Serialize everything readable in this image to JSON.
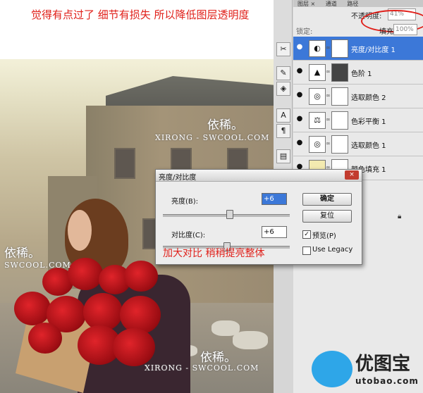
{
  "annotations": {
    "top_note": "觉得有点过了  细节有损失   所以降低图层透明度",
    "dialog_note": "加大对比   稍稍提亮整体"
  },
  "watermarks": [
    {
      "cn": "依稀。",
      "en": "XIRONG - SWCOOL.COM"
    },
    {
      "cn": "依稀。",
      "en": "SWCOOL.COM"
    },
    {
      "cn": "依稀。",
      "en": "XIRONG - SWCOOL.COM"
    }
  ],
  "layers_panel": {
    "tabs": [
      "图层 ×",
      "通道",
      "路径"
    ],
    "opacity_label": "不透明度:",
    "opacity_value": "41%",
    "lock_label": "锁定:",
    "fill_label": "填充:",
    "fill_value": "100%",
    "layers": [
      {
        "name": "亮度/对比度 1",
        "selected": true,
        "icon": "brightness-contrast-icon"
      },
      {
        "name": "色阶 1",
        "selected": false,
        "icon": "levels-icon"
      },
      {
        "name": "选取颜色 2",
        "selected": false,
        "icon": "selective-color-icon"
      },
      {
        "name": "色彩平衡 1",
        "selected": false,
        "icon": "color-balance-icon"
      },
      {
        "name": "选取颜色 1",
        "selected": false,
        "icon": "selective-color-icon"
      },
      {
        "name": "颜色填充 1",
        "selected": false,
        "icon": "color-fill-icon"
      }
    ]
  },
  "dialog": {
    "title": "亮度/对比度",
    "close": "×",
    "brightness_label": "亮度(B):",
    "brightness_value": "+6",
    "contrast_label": "对比度(C):",
    "contrast_value": "+6",
    "ok_label": "确定",
    "reset_label": "复位",
    "preview_label": "预览(P)",
    "preview_checked": true,
    "legacy_label": "Use Legacy",
    "legacy_checked": false,
    "brightness_level": 0.52,
    "contrast_level": 0.5
  },
  "logo": {
    "name": "优图宝",
    "url": "utobao.com"
  },
  "colors": {
    "annotation_red": "#e0201a",
    "selection_blue": "#3c78d8",
    "logo_blue": "#2ea6e8"
  }
}
